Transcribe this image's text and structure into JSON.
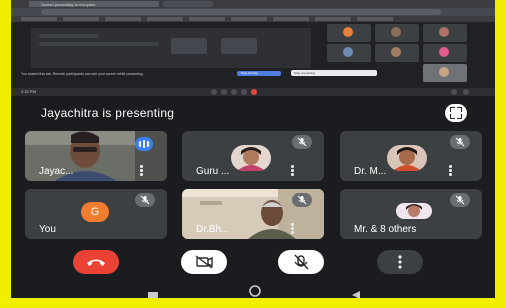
{
  "banner": {
    "title": "Jayachitra is presenting",
    "fullscreen_icon": "fullscreen-icon"
  },
  "shared_screen": {
    "tab_label": "Screen presenting to everyone",
    "time": "2:32 PM",
    "message": "You shared this tab. Remote participants can see your screen while presenting.",
    "popup_text": "Stop presenting",
    "button_text": "Stop sharing"
  },
  "participants": [
    {
      "name": "Jayac...",
      "type": "video",
      "speaking": true,
      "muted": false
    },
    {
      "name": "Guru ...",
      "type": "avatar-photo",
      "muted": true
    },
    {
      "name": "Dr. M...",
      "type": "avatar-photo",
      "muted": true
    },
    {
      "name": "You",
      "type": "initial",
      "initial": "G",
      "avatar_color": "#f07c2e",
      "muted": true
    },
    {
      "name": "Dr.Bh...",
      "type": "video",
      "muted": true
    },
    {
      "name": "Mr. & 8 others",
      "type": "avatar-photo",
      "muted": true
    }
  ],
  "controls": {
    "end_call_icon": "end-call-icon",
    "camera_off_icon": "camera-off-icon",
    "mic_off_icon": "mic-off-icon",
    "more_icon": "more-options-icon",
    "end_call_color": "#ea4335"
  },
  "nav": {
    "recents_icon": "recents-icon",
    "home_icon": "home-icon",
    "back_icon": "back-icon"
  }
}
